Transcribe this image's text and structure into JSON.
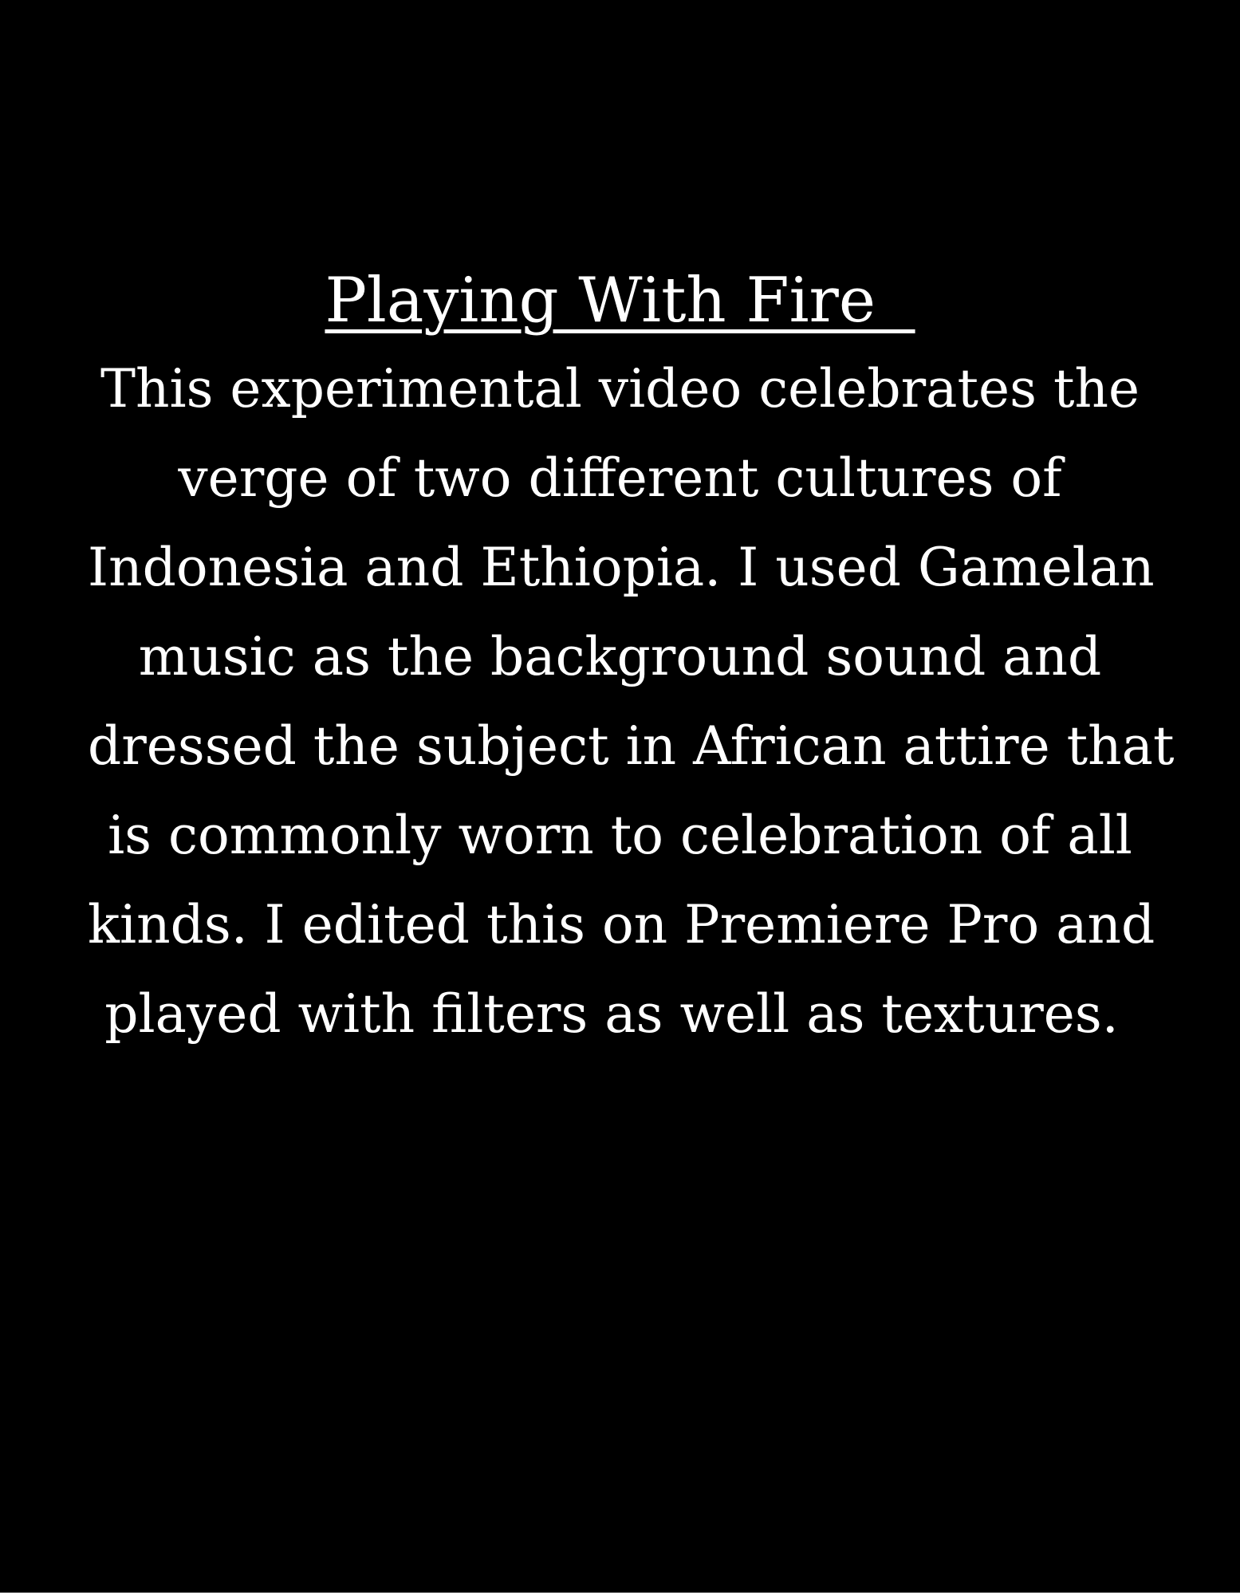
{
  "document": {
    "title": "Playing With Fire  ",
    "body_lines": [
      "This experimental video celebrates the",
      "verge of two different cultures of",
      "Indonesia and Ethiopia. I used Gamelan",
      "music as the background sound and",
      "dressed the subject in African attire that",
      "is commonly worn to celebration of all",
      "kinds. I edited this on Premiere Pro and",
      "played with filters as well as textures. "
    ]
  },
  "colors": {
    "background": "#000000",
    "text": "#ffffff"
  }
}
